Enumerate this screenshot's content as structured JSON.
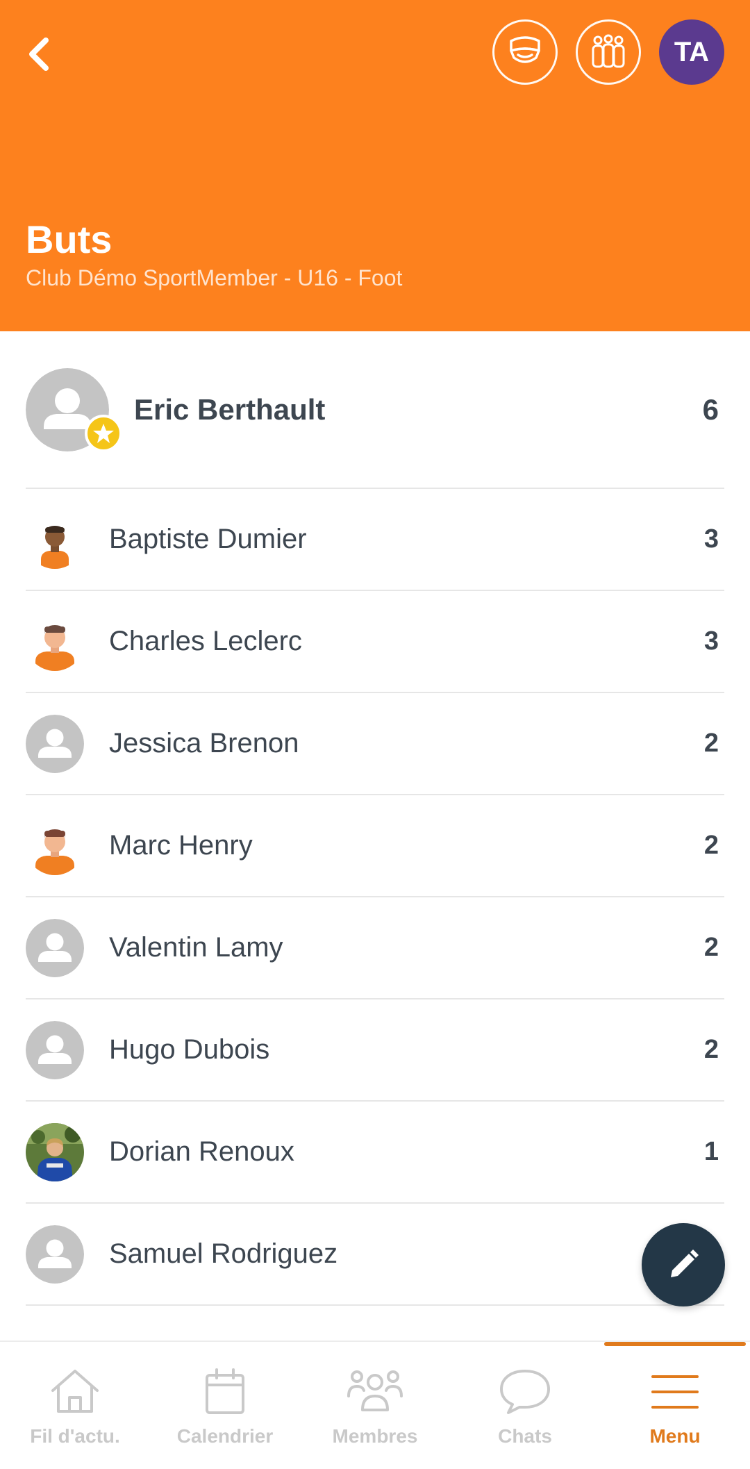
{
  "header": {
    "title": "Buts",
    "subtitle": "Club Démo SportMember - U16 - Foot",
    "avatar_initials": "TA",
    "color": "#fd811e",
    "avatar_color": "#5b3a8f"
  },
  "top_scorer": {
    "name": "Eric Berthault",
    "count": "6",
    "avatar": "default-avatar",
    "badge": "star-icon"
  },
  "players": [
    {
      "name": "Baptiste Dumier",
      "count": "3",
      "avatar": "player-avatar-dark"
    },
    {
      "name": "Charles Leclerc",
      "count": "3",
      "avatar": "player-avatar-light"
    },
    {
      "name": "Jessica Brenon",
      "count": "2",
      "avatar": "default-avatar"
    },
    {
      "name": "Marc Henry",
      "count": "2",
      "avatar": "player-avatar-light"
    },
    {
      "name": "Valentin Lamy",
      "count": "2",
      "avatar": "default-avatar"
    },
    {
      "name": "Hugo Dubois",
      "count": "2",
      "avatar": "default-avatar"
    },
    {
      "name": "Dorian Renoux",
      "count": "1",
      "avatar": "photo-avatar"
    },
    {
      "name": "Samuel Rodriguez",
      "count": "",
      "avatar": "default-avatar"
    }
  ],
  "nav": [
    {
      "label": "Fil d'actu.",
      "icon": "home-icon"
    },
    {
      "label": "Calendrier",
      "icon": "calendar-icon"
    },
    {
      "label": "Membres",
      "icon": "members-icon"
    },
    {
      "label": "Chats",
      "icon": "chat-icon"
    },
    {
      "label": "Menu",
      "icon": "menu-icon",
      "active": true
    }
  ],
  "accent": "#e07a1c",
  "fab_icon": "pencil-icon"
}
